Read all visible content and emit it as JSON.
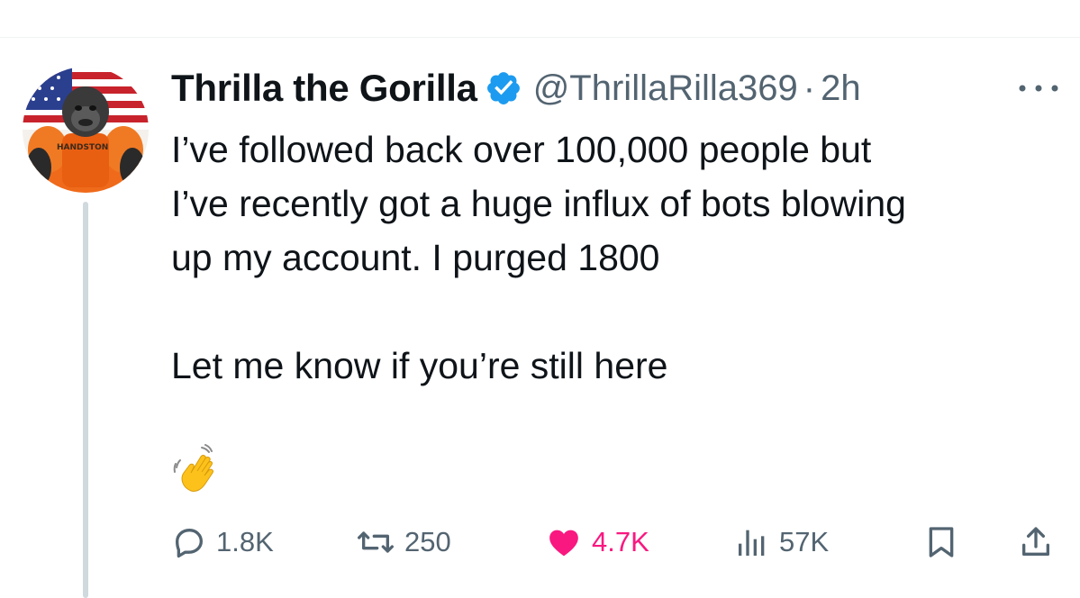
{
  "tweet": {
    "display_name": "Thrilla the Gorilla",
    "handle": "@ThrillaRilla369",
    "separator": "·",
    "time": "2h",
    "verified": true,
    "text": "I’ve followed back over 100,000 people but\nI’ve recently got a huge influx of bots blowing\nup my account. I purged 1800\n\nLet me know if you’re still here",
    "emoji": "waving-hand"
  },
  "avatar": {
    "alt": "gorilla avatar in orange jumpsuit with US flag",
    "shirt_text": "HANDSTON"
  },
  "actions": {
    "replies": "1.8K",
    "reposts": "250",
    "likes": "4.7K",
    "views": "57K"
  },
  "colors": {
    "verified": "#1d9bf0",
    "like": "#f91880",
    "muted": "#536471",
    "thread_line": "#cfd9de"
  },
  "icons": [
    "more-icon",
    "verified-badge-icon",
    "reply-icon",
    "repost-icon",
    "like-icon",
    "views-icon",
    "bookmark-icon",
    "share-icon"
  ]
}
